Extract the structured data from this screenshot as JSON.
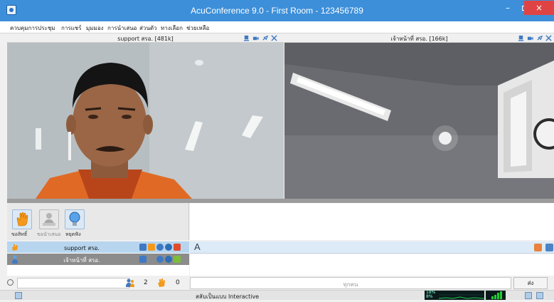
{
  "window": {
    "title": "AcuConference 9.0 - First Room - 123456789",
    "controls": {
      "minimize": "–",
      "close": "×"
    }
  },
  "menu": {
    "items": [
      "ควบคุมการประชุม",
      "การแชร์",
      "มุมมอง",
      "การนำเสนอ",
      "ส่วนตัว",
      "ทางเลือก",
      "ช่วยเหลือ"
    ]
  },
  "video": {
    "left": {
      "title": "support สรอ. [481k]"
    },
    "right": {
      "title": "เจ้าหน้าที่ สรอ. [166k]"
    }
  },
  "controls": {
    "raise_hand": "ขอสิทธิ์",
    "request_present": "ขอนำเสนอ",
    "mute": "หยุดฟัง"
  },
  "participants": [
    {
      "name": "support สรอ."
    },
    {
      "name": "เจ้าหน้าที่ สรอ."
    }
  ],
  "counts": {
    "users": "2",
    "hands": "0"
  },
  "chat": {
    "font_button": "A",
    "recipient": "ทุกคน",
    "send_label": "ส่ง"
  },
  "status": {
    "mode_text": "สลับเป็นแบบ Interactive",
    "cpu_top": "18%",
    "cpu_bottom": "8%"
  },
  "icons": {
    "app": "app-icon",
    "raise_hand": "hand-icon",
    "present": "presenter-icon",
    "mute": "bulb-icon",
    "search": "search-icon",
    "users": "users-icon",
    "hand": "hand-icon"
  },
  "colors": {
    "titlebar": "#3d8fd9",
    "close": "#e04343",
    "row_selected": "#b7d5ee",
    "row_active": "#8c8c8c",
    "chat_strip": "#ddeaf7"
  }
}
